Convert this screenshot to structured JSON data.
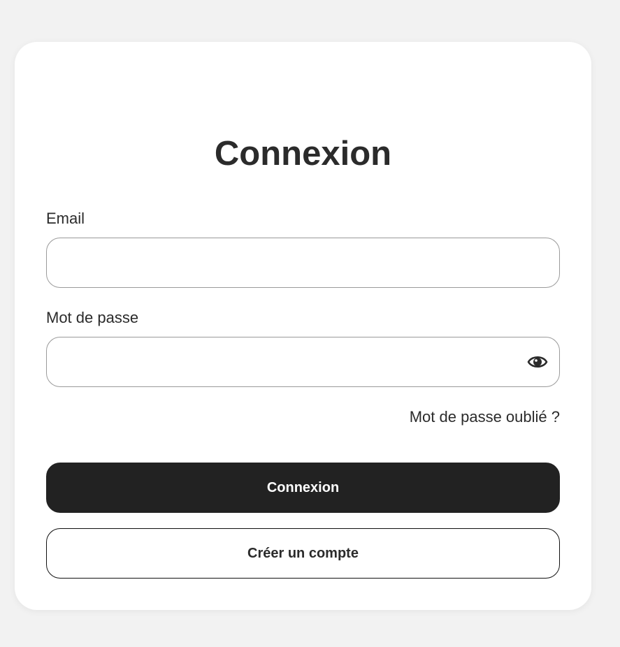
{
  "login": {
    "title": "Connexion",
    "email": {
      "label": "Email",
      "value": "",
      "placeholder": ""
    },
    "password": {
      "label": "Mot de passe",
      "value": "",
      "placeholder": "",
      "toggle_icon": "eye-icon"
    },
    "forgot_password": "Mot de passe oublié ?",
    "submit_label": "Connexion",
    "create_account_label": "Créer un compte"
  },
  "colors": {
    "page_background": "#f2f2f2",
    "card_background": "#ffffff",
    "text": "#2b2b2b",
    "primary_button": "#222222",
    "primary_button_text": "#ffffff",
    "input_border": "#9a9a9a"
  }
}
